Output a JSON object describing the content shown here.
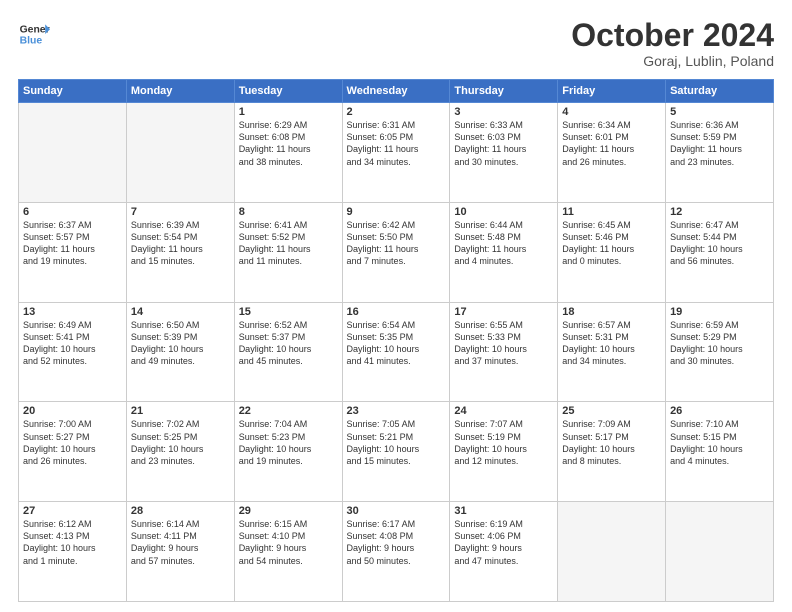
{
  "header": {
    "logo_line1": "General",
    "logo_line2": "Blue",
    "month": "October 2024",
    "location": "Goraj, Lublin, Poland"
  },
  "weekdays": [
    "Sunday",
    "Monday",
    "Tuesday",
    "Wednesday",
    "Thursday",
    "Friday",
    "Saturday"
  ],
  "weeks": [
    [
      {
        "day": "",
        "info": ""
      },
      {
        "day": "",
        "info": ""
      },
      {
        "day": "1",
        "info": "Sunrise: 6:29 AM\nSunset: 6:08 PM\nDaylight: 11 hours\nand 38 minutes."
      },
      {
        "day": "2",
        "info": "Sunrise: 6:31 AM\nSunset: 6:05 PM\nDaylight: 11 hours\nand 34 minutes."
      },
      {
        "day": "3",
        "info": "Sunrise: 6:33 AM\nSunset: 6:03 PM\nDaylight: 11 hours\nand 30 minutes."
      },
      {
        "day": "4",
        "info": "Sunrise: 6:34 AM\nSunset: 6:01 PM\nDaylight: 11 hours\nand 26 minutes."
      },
      {
        "day": "5",
        "info": "Sunrise: 6:36 AM\nSunset: 5:59 PM\nDaylight: 11 hours\nand 23 minutes."
      }
    ],
    [
      {
        "day": "6",
        "info": "Sunrise: 6:37 AM\nSunset: 5:57 PM\nDaylight: 11 hours\nand 19 minutes."
      },
      {
        "day": "7",
        "info": "Sunrise: 6:39 AM\nSunset: 5:54 PM\nDaylight: 11 hours\nand 15 minutes."
      },
      {
        "day": "8",
        "info": "Sunrise: 6:41 AM\nSunset: 5:52 PM\nDaylight: 11 hours\nand 11 minutes."
      },
      {
        "day": "9",
        "info": "Sunrise: 6:42 AM\nSunset: 5:50 PM\nDaylight: 11 hours\nand 7 minutes."
      },
      {
        "day": "10",
        "info": "Sunrise: 6:44 AM\nSunset: 5:48 PM\nDaylight: 11 hours\nand 4 minutes."
      },
      {
        "day": "11",
        "info": "Sunrise: 6:45 AM\nSunset: 5:46 PM\nDaylight: 11 hours\nand 0 minutes."
      },
      {
        "day": "12",
        "info": "Sunrise: 6:47 AM\nSunset: 5:44 PM\nDaylight: 10 hours\nand 56 minutes."
      }
    ],
    [
      {
        "day": "13",
        "info": "Sunrise: 6:49 AM\nSunset: 5:41 PM\nDaylight: 10 hours\nand 52 minutes."
      },
      {
        "day": "14",
        "info": "Sunrise: 6:50 AM\nSunset: 5:39 PM\nDaylight: 10 hours\nand 49 minutes."
      },
      {
        "day": "15",
        "info": "Sunrise: 6:52 AM\nSunset: 5:37 PM\nDaylight: 10 hours\nand 45 minutes."
      },
      {
        "day": "16",
        "info": "Sunrise: 6:54 AM\nSunset: 5:35 PM\nDaylight: 10 hours\nand 41 minutes."
      },
      {
        "day": "17",
        "info": "Sunrise: 6:55 AM\nSunset: 5:33 PM\nDaylight: 10 hours\nand 37 minutes."
      },
      {
        "day": "18",
        "info": "Sunrise: 6:57 AM\nSunset: 5:31 PM\nDaylight: 10 hours\nand 34 minutes."
      },
      {
        "day": "19",
        "info": "Sunrise: 6:59 AM\nSunset: 5:29 PM\nDaylight: 10 hours\nand 30 minutes."
      }
    ],
    [
      {
        "day": "20",
        "info": "Sunrise: 7:00 AM\nSunset: 5:27 PM\nDaylight: 10 hours\nand 26 minutes."
      },
      {
        "day": "21",
        "info": "Sunrise: 7:02 AM\nSunset: 5:25 PM\nDaylight: 10 hours\nand 23 minutes."
      },
      {
        "day": "22",
        "info": "Sunrise: 7:04 AM\nSunset: 5:23 PM\nDaylight: 10 hours\nand 19 minutes."
      },
      {
        "day": "23",
        "info": "Sunrise: 7:05 AM\nSunset: 5:21 PM\nDaylight: 10 hours\nand 15 minutes."
      },
      {
        "day": "24",
        "info": "Sunrise: 7:07 AM\nSunset: 5:19 PM\nDaylight: 10 hours\nand 12 minutes."
      },
      {
        "day": "25",
        "info": "Sunrise: 7:09 AM\nSunset: 5:17 PM\nDaylight: 10 hours\nand 8 minutes."
      },
      {
        "day": "26",
        "info": "Sunrise: 7:10 AM\nSunset: 5:15 PM\nDaylight: 10 hours\nand 4 minutes."
      }
    ],
    [
      {
        "day": "27",
        "info": "Sunrise: 6:12 AM\nSunset: 4:13 PM\nDaylight: 10 hours\nand 1 minute."
      },
      {
        "day": "28",
        "info": "Sunrise: 6:14 AM\nSunset: 4:11 PM\nDaylight: 9 hours\nand 57 minutes."
      },
      {
        "day": "29",
        "info": "Sunrise: 6:15 AM\nSunset: 4:10 PM\nDaylight: 9 hours\nand 54 minutes."
      },
      {
        "day": "30",
        "info": "Sunrise: 6:17 AM\nSunset: 4:08 PM\nDaylight: 9 hours\nand 50 minutes."
      },
      {
        "day": "31",
        "info": "Sunrise: 6:19 AM\nSunset: 4:06 PM\nDaylight: 9 hours\nand 47 minutes."
      },
      {
        "day": "",
        "info": ""
      },
      {
        "day": "",
        "info": ""
      }
    ]
  ]
}
